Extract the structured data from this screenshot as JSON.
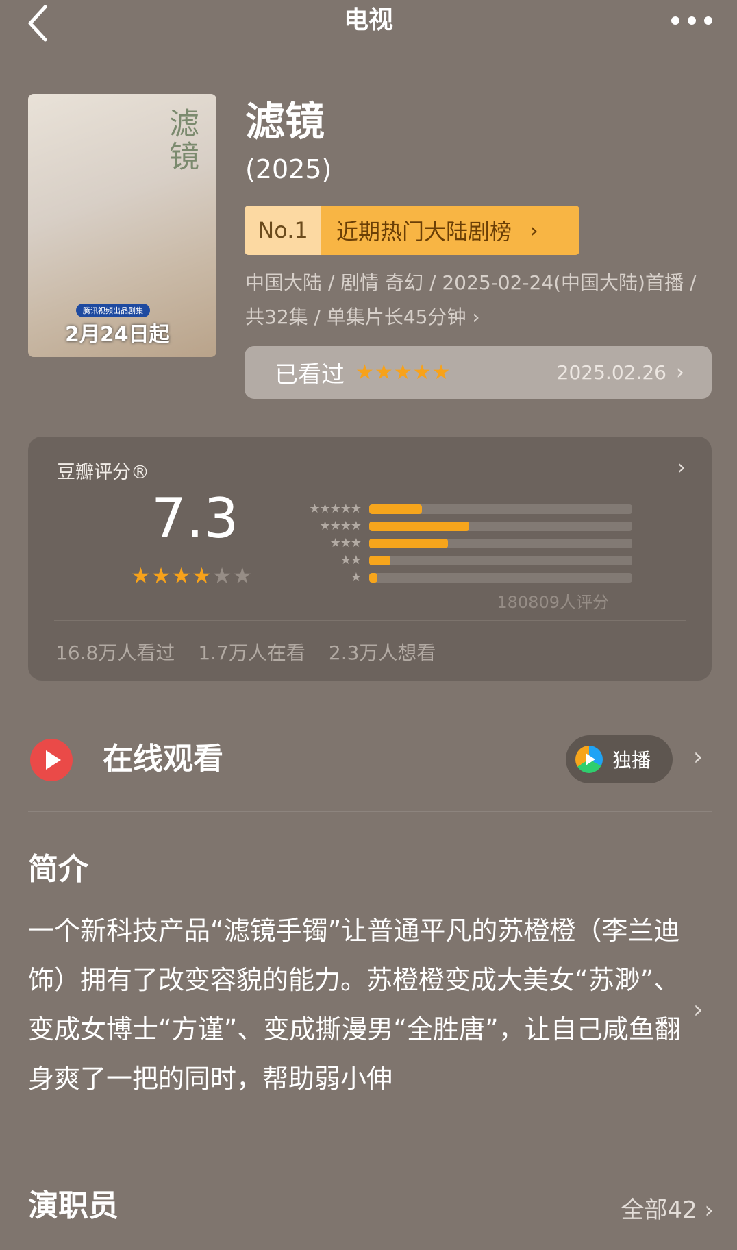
{
  "header": {
    "title": "电视"
  },
  "poster": {
    "calligraphy": "滤镜",
    "badge": "腾讯视频出品剧集",
    "date_text": "2月24日起"
  },
  "movie": {
    "name": "滤镜",
    "year": "(2025)",
    "rank_no": "No.1",
    "rank_label": "近期热门大陆剧榜",
    "meta": "中国大陆 / 剧情 奇幻 / 2025-02-24(中国大陆)首播 / 共32集 / 单集片长45分钟 ›"
  },
  "watched": {
    "label": "已看过",
    "rating": 5,
    "stars_text": "★★★★★",
    "date": "2025.02.26"
  },
  "rating_card": {
    "title": "豆瓣评分®",
    "score": "7.3",
    "score_stars": {
      "full": "★★★",
      "half": "★",
      "empty": "★★"
    },
    "distribution": [
      {
        "stars": "★★★★★",
        "percent": 20
      },
      {
        "stars": "★★★★",
        "percent": 38
      },
      {
        "stars": "★★★",
        "percent": 30
      },
      {
        "stars": "★★",
        "percent": 8
      },
      {
        "stars": "★",
        "percent": 3
      }
    ],
    "votes": "180809人评分",
    "stats": {
      "watched": "16.8万人看过",
      "watching": "1.7万人在看",
      "wish": "2.3万人想看"
    }
  },
  "online": {
    "label": "在线观看",
    "exclusive": "独播"
  },
  "intro": {
    "title": "简介",
    "text": "一个新科技产品“滤镜手镯”让普通平凡的苏橙橙（李兰迪 饰）拥有了改变容貌的能力。苏橙橙变成大美女“苏渺”、变成女博士“方谨”、变成撕漫男“全胜唐”，让自己咸鱼翻身爽了一把的同时，帮助弱小伸"
  },
  "cast": {
    "title": "演职员",
    "all": "全部42 ›"
  },
  "colors": {
    "background": "#7f756e",
    "accent": "#f6a51c",
    "play": "#ea4a48",
    "card": "#6c635d"
  }
}
